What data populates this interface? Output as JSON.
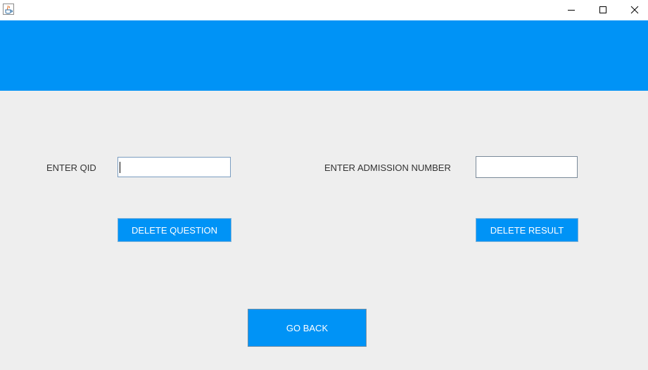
{
  "window": {
    "app_icon": "java-cup-icon",
    "controls": [
      "minimize-icon",
      "maximize-icon",
      "close-icon"
    ]
  },
  "colors": {
    "accent": "#0093f6",
    "background": "#eeeeee",
    "label_text": "#333333",
    "button_text": "#ffffff"
  },
  "form": {
    "qid_label": "ENTER QID",
    "qid_value": "",
    "admission_label": "ENTER ADMISSION NUMBER",
    "admission_value": "",
    "delete_question_label": "DELETE QUESTION",
    "delete_result_label": "DELETE RESULT",
    "go_back_label": "GO BACK"
  }
}
